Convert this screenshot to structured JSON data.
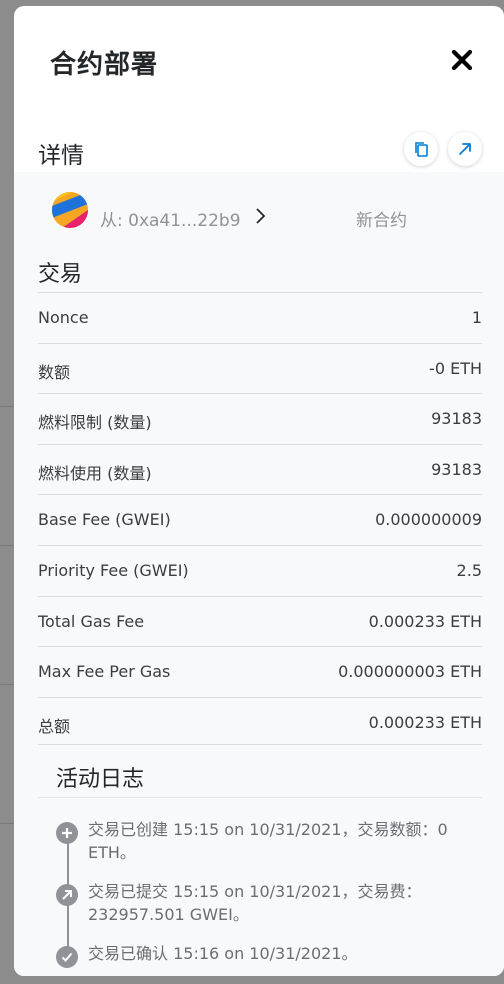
{
  "modal": {
    "title": "合约部署",
    "close_icon": "close-icon"
  },
  "details": {
    "title": "详情",
    "copy_icon": "copy-icon",
    "open_icon": "external-link-icon"
  },
  "from_row": {
    "from_label": "从: 0xa41...22b9",
    "to_label": "新合约"
  },
  "transaction": {
    "title": "交易",
    "rows": [
      {
        "label": "Nonce",
        "value": "1"
      },
      {
        "label": "数额",
        "value": "-0 ETH"
      },
      {
        "label": "燃料限制 (数量)",
        "value": "93183"
      },
      {
        "label": "燃料使用 (数量)",
        "value": "93183"
      },
      {
        "label": "Base Fee (GWEI)",
        "value": "0.000000009"
      },
      {
        "label": "Priority Fee (GWEI)",
        "value": "2.5"
      },
      {
        "label": "Total Gas Fee",
        "value": "0.000233 ETH"
      },
      {
        "label": "Max Fee Per Gas",
        "value": "0.000000003 ETH"
      },
      {
        "label": "总额",
        "value": "0.000233 ETH"
      }
    ]
  },
  "activity": {
    "title": "活动日志",
    "items": [
      {
        "icon": "plus-icon",
        "text": "交易已创建 15:15 on 10/31/2021，交易数额：0 ETH。"
      },
      {
        "icon": "arrow-up-right-icon",
        "text": "交易已提交 15:15 on 10/31/2021，交易费：232957.501 GWEI。"
      },
      {
        "icon": "check-icon",
        "text": "交易已确认 15:16 on 10/31/2021。"
      }
    ]
  },
  "colors": {
    "accent": "#037dd6",
    "text": "#24272a",
    "muted": "#8f9398",
    "backdrop": "#8c8c8c"
  }
}
